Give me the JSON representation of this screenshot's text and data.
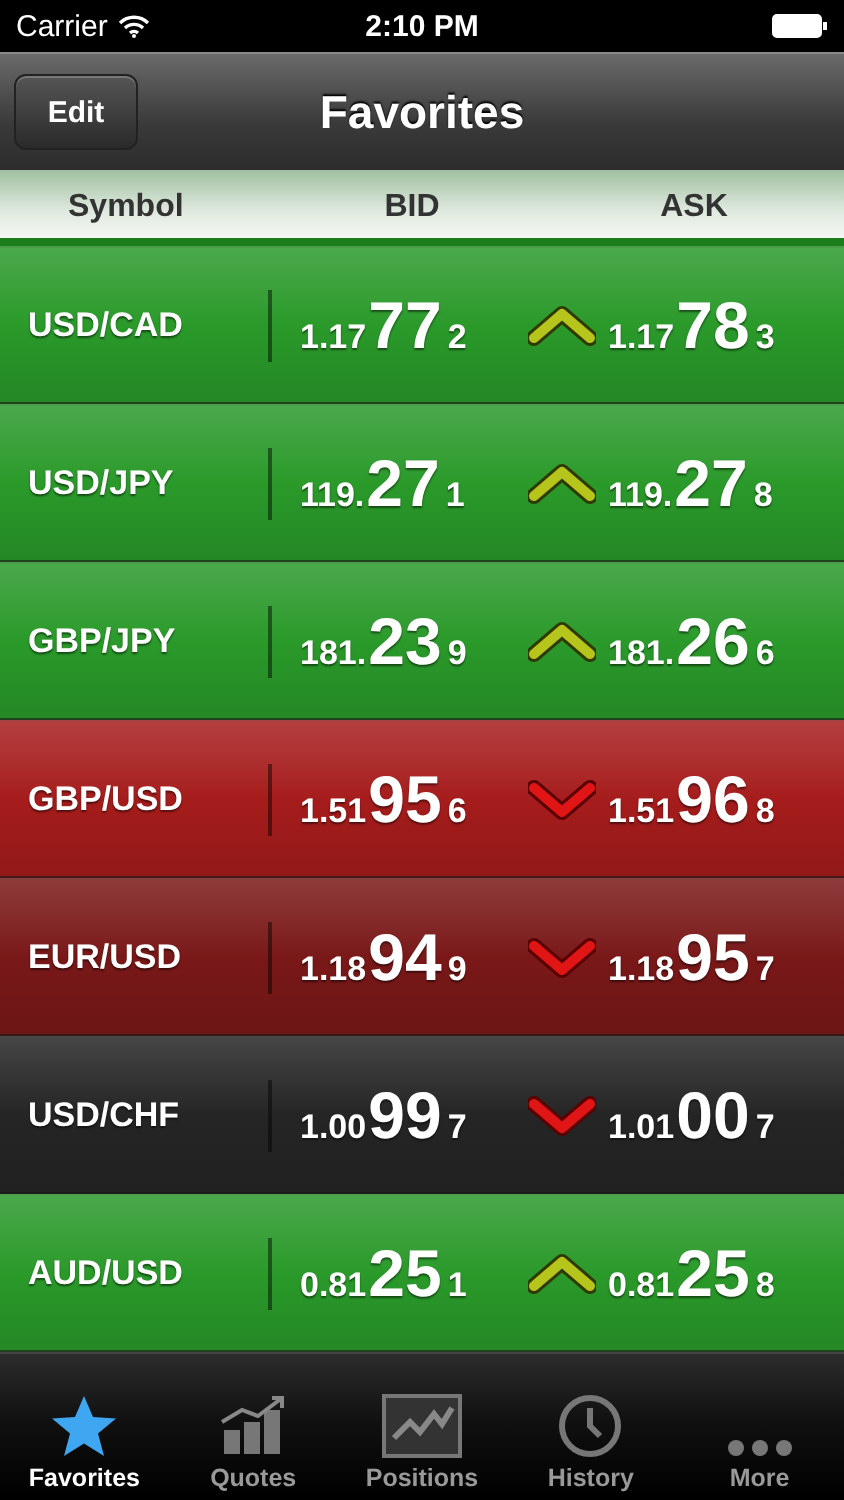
{
  "status_bar": {
    "carrier": "Carrier",
    "time": "2:10 PM"
  },
  "nav_bar": {
    "edit_button": "Edit",
    "title": "Favorites"
  },
  "columns": [
    "Symbol",
    "BID",
    "ASK"
  ],
  "rows": [
    {
      "symbol": "USD/CAD",
      "color": "#2a9a2a",
      "kind": "up",
      "bid": {
        "prefix": "1.17",
        "big": "77",
        "pip": "2"
      },
      "ask": {
        "prefix": "1.17",
        "big": "78",
        "pip": "3"
      }
    },
    {
      "symbol": "USD/JPY",
      "color": "#2a9a2a",
      "kind": "up",
      "bid": {
        "prefix": "119.",
        "big": "27",
        "pip": "1"
      },
      "ask": {
        "prefix": "119.",
        "big": "27",
        "pip": "8"
      }
    },
    {
      "symbol": "GBP/JPY",
      "color": "#2a9a2a",
      "kind": "up",
      "bid": {
        "prefix": "181.",
        "big": "23",
        "pip": "9"
      },
      "ask": {
        "prefix": "181.",
        "big": "26",
        "pip": "6"
      }
    },
    {
      "symbol": "GBP/USD",
      "color": "#a61c1c",
      "kind": "down",
      "bid": {
        "prefix": "1.51",
        "big": "95",
        "pip": "6"
      },
      "ask": {
        "prefix": "1.51",
        "big": "96",
        "pip": "8"
      }
    },
    {
      "symbol": "EUR/USD",
      "color": "#7a1818",
      "kind": "down",
      "bid": {
        "prefix": "1.18",
        "big": "94",
        "pip": "9"
      },
      "ask": {
        "prefix": "1.18",
        "big": "95",
        "pip": "7"
      }
    },
    {
      "symbol": "USD/CHF",
      "color": "#252525",
      "kind": "down",
      "bid": {
        "prefix": "1.00",
        "big": "99",
        "pip": "7"
      },
      "ask": {
        "prefix": "1.01",
        "big": "00",
        "pip": "7"
      }
    },
    {
      "symbol": "AUD/USD",
      "color": "#2a9a2a",
      "kind": "up",
      "bid": {
        "prefix": "0.81",
        "big": "25",
        "pip": "1"
      },
      "ask": {
        "prefix": "0.81",
        "big": "25",
        "pip": "8"
      }
    }
  ],
  "tabs": [
    {
      "label": "Favorites",
      "kind": "star",
      "selected": true
    },
    {
      "label": "Quotes",
      "kind": "bars",
      "selected": false
    },
    {
      "label": "Positions",
      "kind": "line",
      "selected": false
    },
    {
      "label": "History",
      "kind": "clock",
      "selected": false
    },
    {
      "label": "More",
      "kind": "dots",
      "selected": false
    }
  ]
}
